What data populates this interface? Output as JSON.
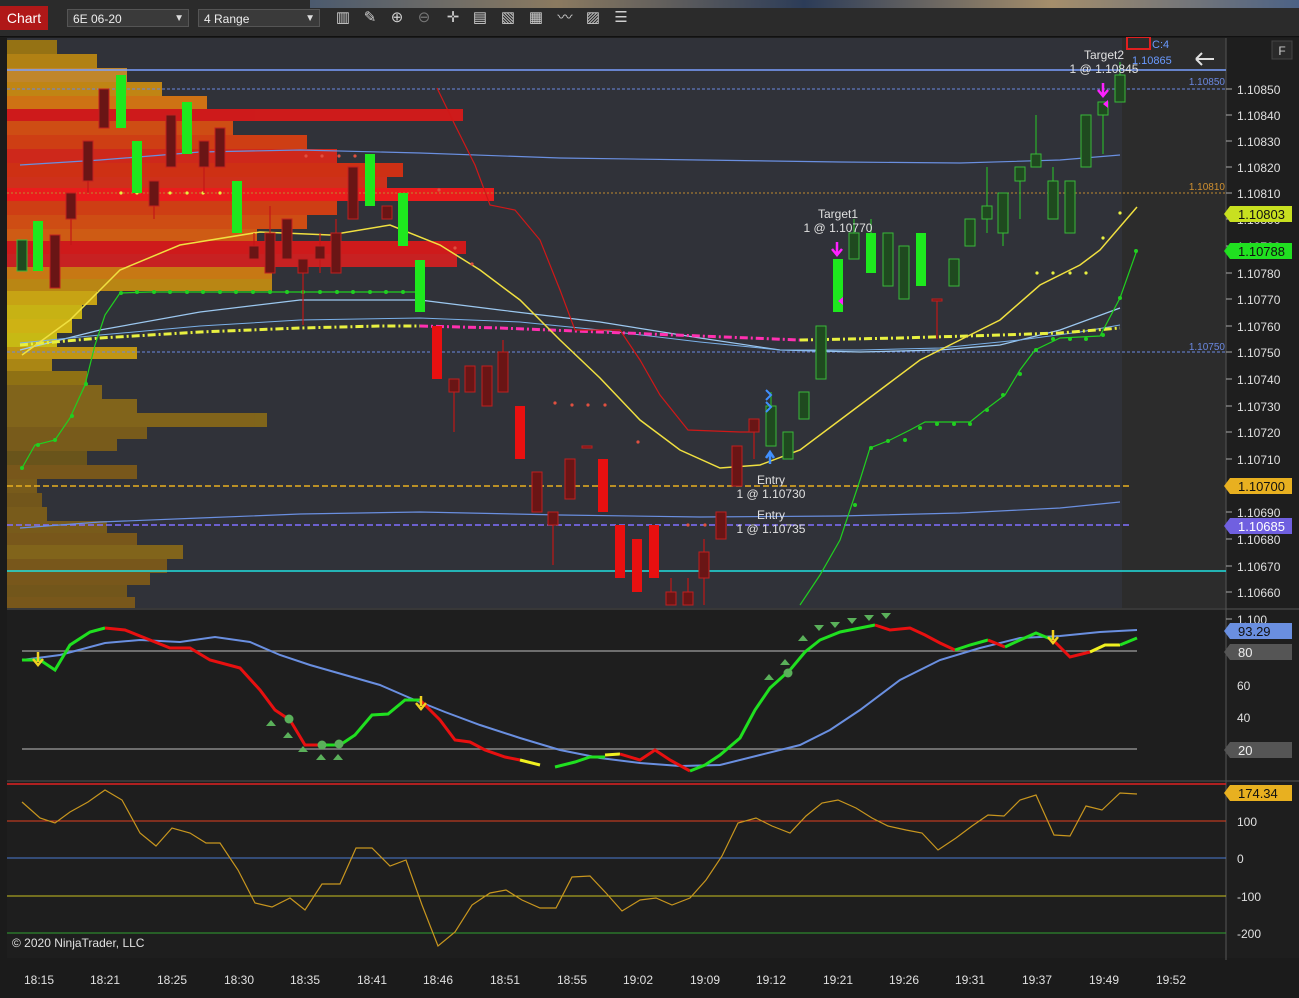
{
  "toolbar": {
    "tab_label": "Chart",
    "instrument": "6E 06-20",
    "bar_type": "4 Range",
    "icons": [
      "bar-style-icon",
      "draw-tool-icon",
      "zoom-in-icon",
      "zoom-out-icon",
      "crosshair-icon",
      "data-box-icon",
      "indicators-icon",
      "strategies-icon",
      "chart-trader-icon",
      "properties-icon"
    ],
    "f_button": "F"
  },
  "price_panel": {
    "y_ticks": [
      "1.10850",
      "1.10840",
      "1.10830",
      "1.10820",
      "1.10810",
      "1.10800",
      "1.10790",
      "1.10780",
      "1.10770",
      "1.10760",
      "1.10750",
      "1.10740",
      "1.10730",
      "1.10720",
      "1.10710",
      "1.10700",
      "1.10690",
      "1.10680",
      "1.10670",
      "1.10660",
      "1.100"
    ],
    "line_labels": {
      "l10850": "1.10850",
      "l10810": "1.10810",
      "l10750": "1.10750"
    },
    "badges": {
      "b10803": "1.10803",
      "b10788": "1.10788",
      "b10700": "1.10700",
      "b10685": "1.10685"
    },
    "top_label": {
      "c": "C:4",
      "price": "1.10865"
    },
    "orders": {
      "target2_name": "Target2",
      "target2_qty": "1 @ 1.10845",
      "target1_name": "Target1",
      "target1_qty": "1 @ 1.10770",
      "entry1_name": "Entry",
      "entry1_qty": "1 @ 1.10730",
      "entry2_name": "Entry",
      "entry2_qty": "1 @ 1.10735"
    },
    "colors": {
      "up": "#1ee81e",
      "down": "#e81010",
      "axis_bg": "#1e1e1e"
    }
  },
  "stoch_panel": {
    "ticks": [
      "60",
      "40"
    ],
    "badges": {
      "value": "93.29",
      "upper": "80",
      "lower": "20"
    }
  },
  "cci_panel": {
    "ticks": [
      "100",
      "0",
      "-100",
      "-200"
    ],
    "badge": "174.34"
  },
  "copyright": "© 2020 NinjaTrader, LLC",
  "time_axis": [
    "18:15",
    "18:21",
    "18:25",
    "18:30",
    "18:35",
    "18:41",
    "18:46",
    "18:51",
    "18:55",
    "19:02",
    "19:09",
    "19:12",
    "19:21",
    "19:26",
    "19:31",
    "19:37",
    "19:49",
    "19:52"
  ]
}
